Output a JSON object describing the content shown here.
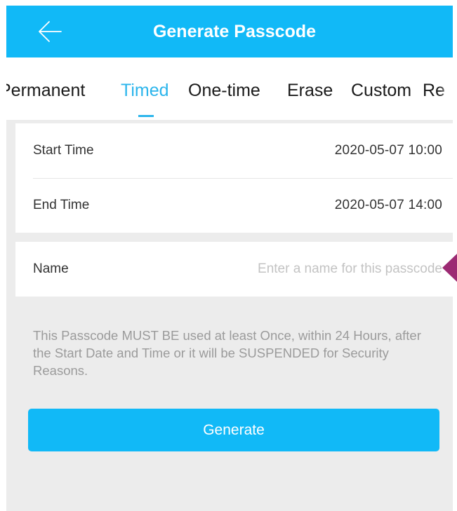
{
  "header": {
    "title": "Generate Passcode",
    "back_icon": "arrow-left-icon"
  },
  "tabs": [
    {
      "label": "Permanent",
      "active": false
    },
    {
      "label": "Timed",
      "active": true
    },
    {
      "label": "One-time",
      "active": false
    },
    {
      "label": "Erase",
      "active": false
    },
    {
      "label": "Custom",
      "active": false
    },
    {
      "label": "Re",
      "active": false
    }
  ],
  "time_card": {
    "start_time": {
      "label": "Start Time",
      "value": "2020-05-07 10:00"
    },
    "end_time": {
      "label": "End Time",
      "value": "2020-05-07 14:00"
    }
  },
  "name_field": {
    "label": "Name",
    "placeholder": "Enter a name for this passcode",
    "value": ""
  },
  "notice": "This Passcode MUST BE used at least Once, within 24 Hours, after the Start Date and Time or it will be SUSPENDED for Security Reasons.",
  "generate_button": {
    "label": "Generate"
  },
  "colors": {
    "primary": "#11b9f7",
    "active_tab": "#2bb5ec",
    "background": "#ececec",
    "notice_text": "#9b9b9b",
    "placeholder": "#c3c3c3",
    "marker": "#9c2a73"
  }
}
